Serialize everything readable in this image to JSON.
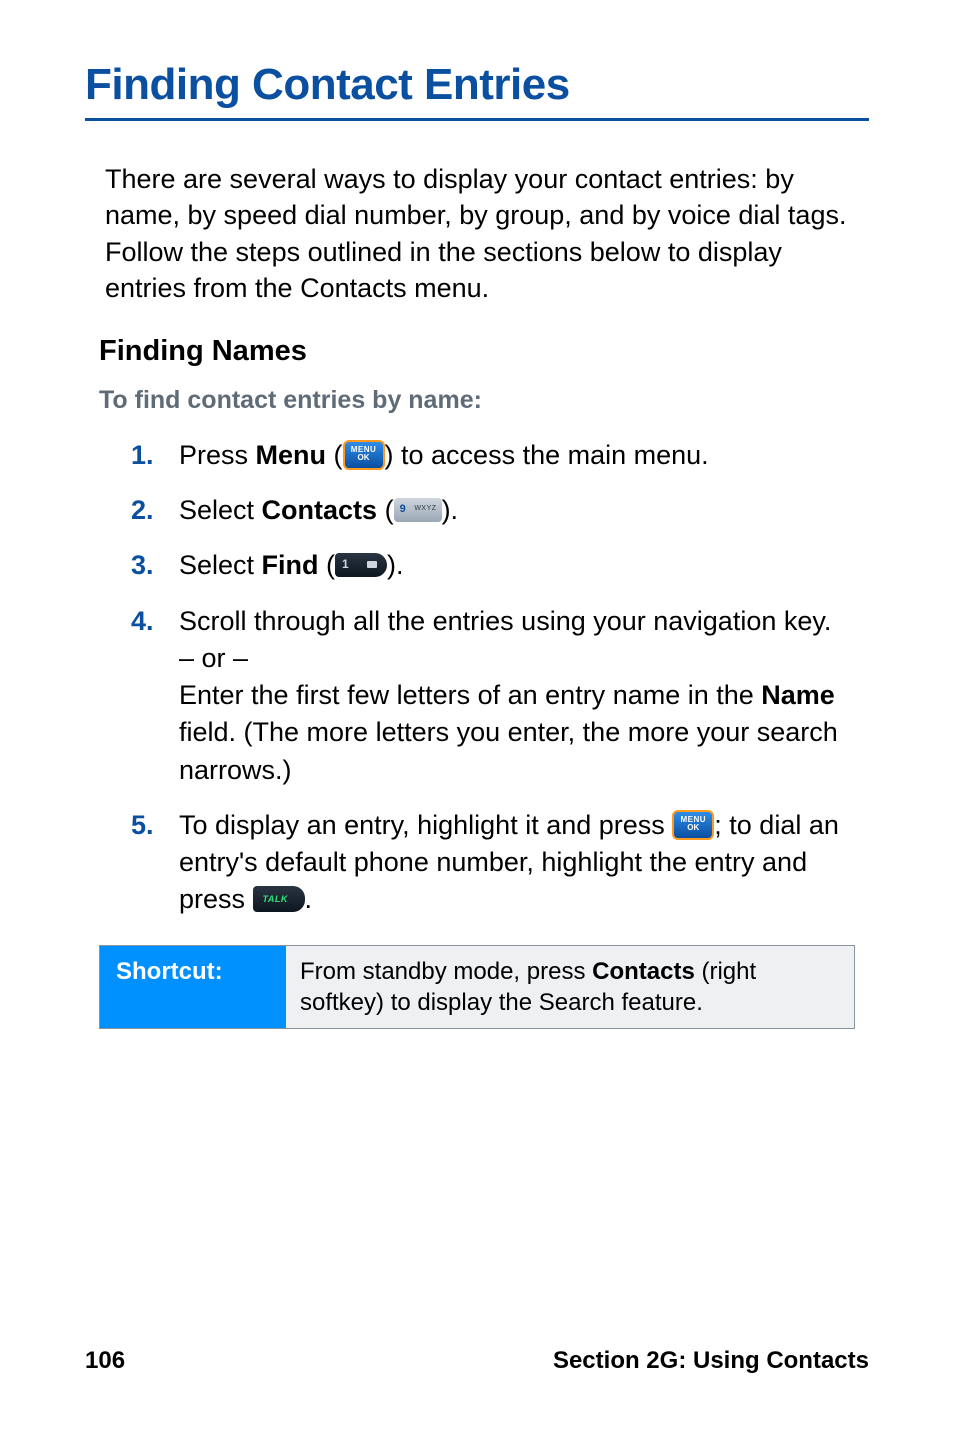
{
  "title": "Finding Contact Entries",
  "intro": "There are several ways to display your contact entries: by name, by speed dial number, by group, and by voice dial tags. Follow the steps outlined in the sections below to display entries from the Contacts menu.",
  "subheading": "Finding Names",
  "prompt": "To find contact entries by name:",
  "steps": {
    "s1": {
      "num": "1.",
      "a": "Press ",
      "menu": "Menu",
      "b": " (",
      "c": ") to access the main menu."
    },
    "s2": {
      "num": "2.",
      "a": "Select ",
      "contacts": "Contacts",
      "b": " (",
      "c": ")."
    },
    "s3": {
      "num": "3.",
      "a": "Select ",
      "find": "Find",
      "b": " (",
      "c": ")."
    },
    "s4": {
      "num": "4.",
      "line1": "Scroll through all the entries using your navigation key.",
      "or": "– or –",
      "line2a": "Enter the first few letters of an entry name in the ",
      "name": "Name",
      "line2b": " field. (The more letters you enter, the more your search narrows.)"
    },
    "s5": {
      "num": "5.",
      "a": "To display an entry, highlight it and press ",
      "b": "; to dial an entry's default phone number, highlight the entry and press ",
      "c": "."
    }
  },
  "shortcut": {
    "label": "Shortcut:",
    "a": "From standby mode, press ",
    "contacts": "Contacts",
    "b": " (right softkey) to display the Search feature."
  },
  "footer": {
    "page": "106",
    "section": "Section 2G: Using Contacts"
  },
  "icons": {
    "menu_l1": "MENU",
    "menu_l2": "OK"
  }
}
